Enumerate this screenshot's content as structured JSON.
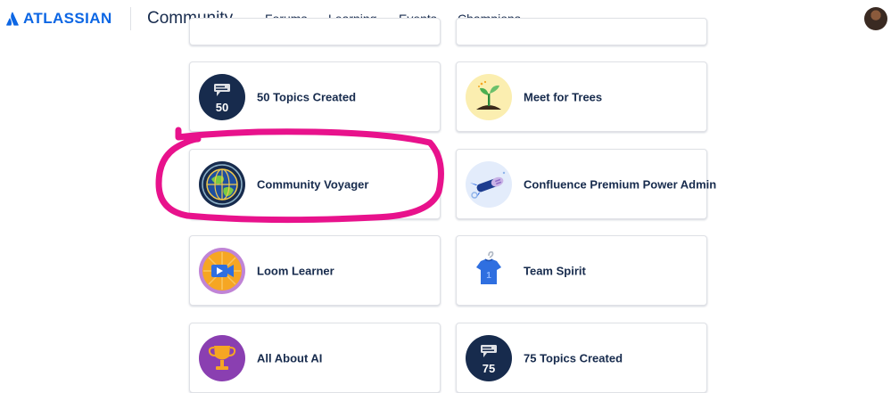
{
  "header": {
    "brand": "ATLASSIAN",
    "product": "Community",
    "nav": [
      "Forums",
      "Learning",
      "Events",
      "Champions"
    ]
  },
  "badges": [
    {
      "title": "50 Topics Created",
      "icon": "chat-count-50-icon",
      "count": "50"
    },
    {
      "title": "Meet for Trees",
      "icon": "sapling-icon"
    },
    {
      "title": "Community Voyager",
      "icon": "globe-icon"
    },
    {
      "title": "Confluence Premium Power Admin",
      "icon": "rocket-icon"
    },
    {
      "title": "Loom Learner",
      "icon": "video-camera-icon"
    },
    {
      "title": "Team Spirit",
      "icon": "jersey-icon"
    },
    {
      "title": "All About AI",
      "icon": "trophy-icon"
    },
    {
      "title": "75 Topics Created",
      "icon": "chat-count-75-icon",
      "count": "75"
    }
  ],
  "colors": {
    "brand": "#0c66e4",
    "text": "#172b4d",
    "annotation": "#e8128c",
    "navy_badge": "#172b4d"
  }
}
